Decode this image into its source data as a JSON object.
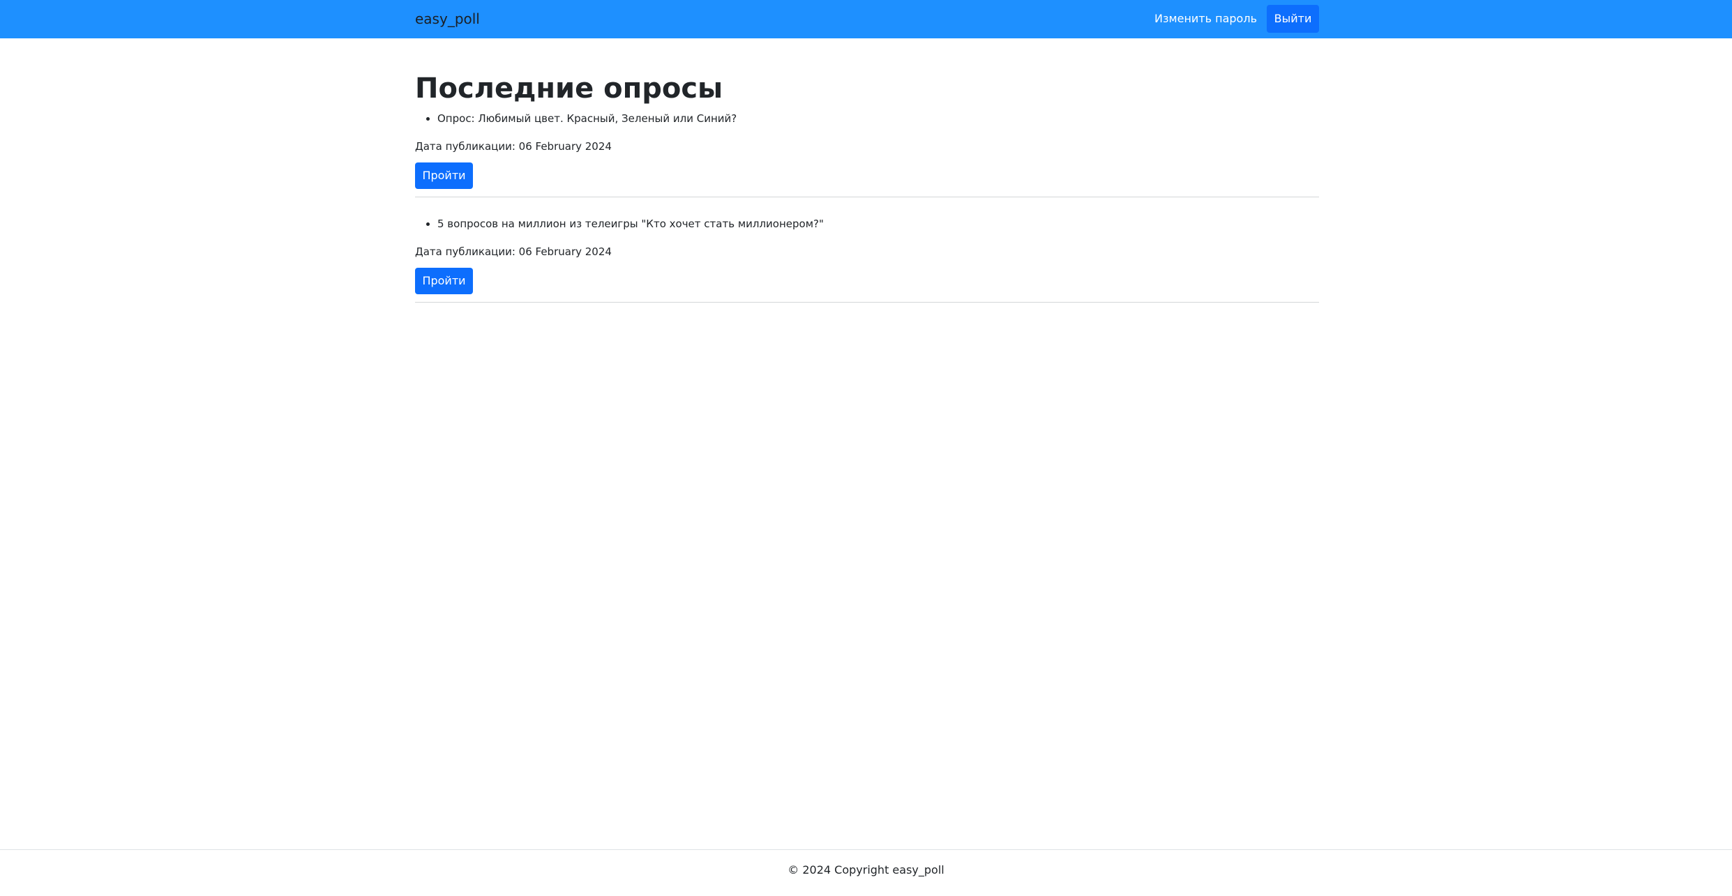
{
  "navbar": {
    "brand": "easy_poll",
    "change_password_label": "Изменить пароль",
    "logout_label": "Выйти",
    "background_color": "#1e90ff",
    "button_color": "#0d6efd"
  },
  "main": {
    "title": "Последние опросы",
    "polls": [
      {
        "name": "Опрос: Любимый цвет. Красный, Зеленый или Синий?",
        "date_text": "Дата публикации: 06 February 2024",
        "button_label": "Пройти"
      },
      {
        "name": "5 вопросов на миллион из телеигры \"Кто хочет стать миллионером?\"",
        "date_text": "Дата публикации: 06 February 2024",
        "button_label": "Пройти"
      }
    ]
  },
  "footer": {
    "text": "© 2024 Copyright easy_poll"
  }
}
